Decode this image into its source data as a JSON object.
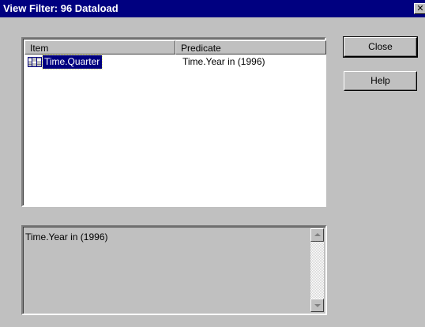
{
  "window": {
    "title": "View Filter: 96 Dataload",
    "close_glyph": "✕"
  },
  "list": {
    "columns": [
      "Item",
      "Predicate"
    ],
    "rows": [
      {
        "icon": "dimension-icon",
        "item": "Time.Quarter",
        "predicate": "Time.Year in (1996)"
      }
    ]
  },
  "detail": {
    "text": "Time.Year in (1996)"
  },
  "buttons": {
    "close": "Close",
    "help": "Help"
  },
  "colors": {
    "titlebar": "#000080",
    "face": "#c0c0c0",
    "selection": "#000080"
  }
}
